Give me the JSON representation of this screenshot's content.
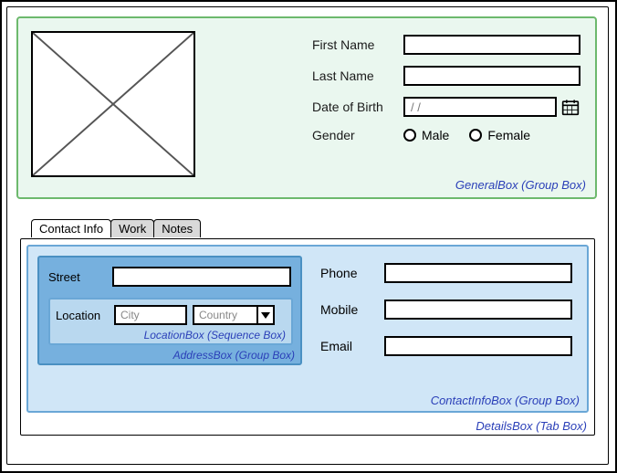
{
  "general": {
    "first_name_label": "First Name",
    "last_name_label": "Last Name",
    "dob_label": "Date of Birth",
    "dob_placeholder": "  /   /",
    "gender_label": "Gender",
    "male_label": "Male",
    "female_label": "Female",
    "caption": "GeneralBox (Group Box)"
  },
  "tabs": {
    "contact": "Contact Info",
    "work": "Work",
    "notes": "Notes"
  },
  "contact": {
    "phone_label": "Phone",
    "mobile_label": "Mobile",
    "email_label": "Email",
    "caption": "ContactInfoBox (Group Box)"
  },
  "address": {
    "street_label": "Street",
    "location_label": "Location",
    "city_placeholder": "City",
    "country_placeholder": "Country",
    "location_caption": "LocationBox (Sequence Box)",
    "address_caption": "AddressBox (Group Box)"
  },
  "details_caption": "DetailsBox (Tab Box)"
}
